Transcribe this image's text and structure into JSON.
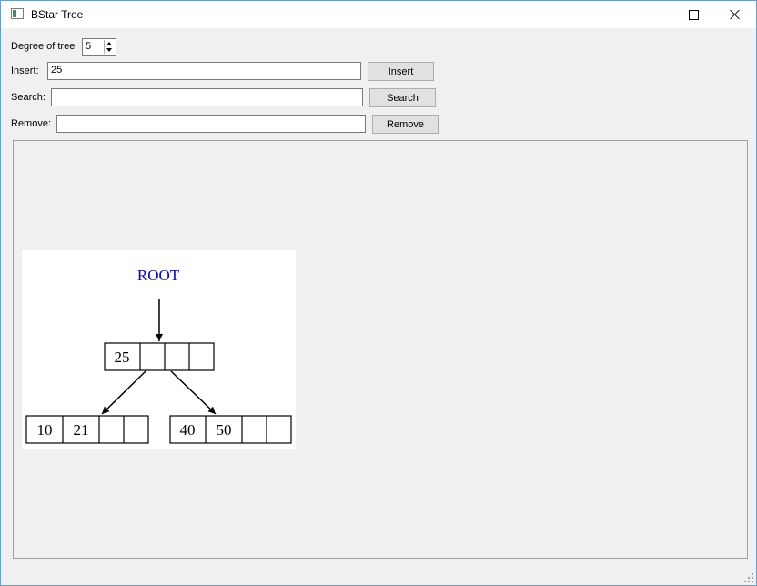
{
  "window": {
    "title": "BStar Tree",
    "icon": "app-window-icon",
    "controls": [
      "minimize-icon",
      "maximize-icon",
      "close-icon"
    ]
  },
  "degree": {
    "label": "Degree of tree",
    "value": "5"
  },
  "insert": {
    "label": "Insert:",
    "value": "25",
    "button": "Insert"
  },
  "search": {
    "label": "Search:",
    "value": "",
    "button": "Search"
  },
  "remove": {
    "label": "Remove:",
    "value": "",
    "button": "Remove"
  },
  "tree": {
    "root_label": "ROOT",
    "root_color": "#0000cc",
    "root_node": {
      "keys": [
        "25",
        "",
        "",
        ""
      ]
    },
    "children": [
      {
        "keys": [
          "10",
          "21",
          "",
          ""
        ]
      },
      {
        "keys": [
          "40",
          "50",
          "",
          ""
        ]
      }
    ]
  }
}
